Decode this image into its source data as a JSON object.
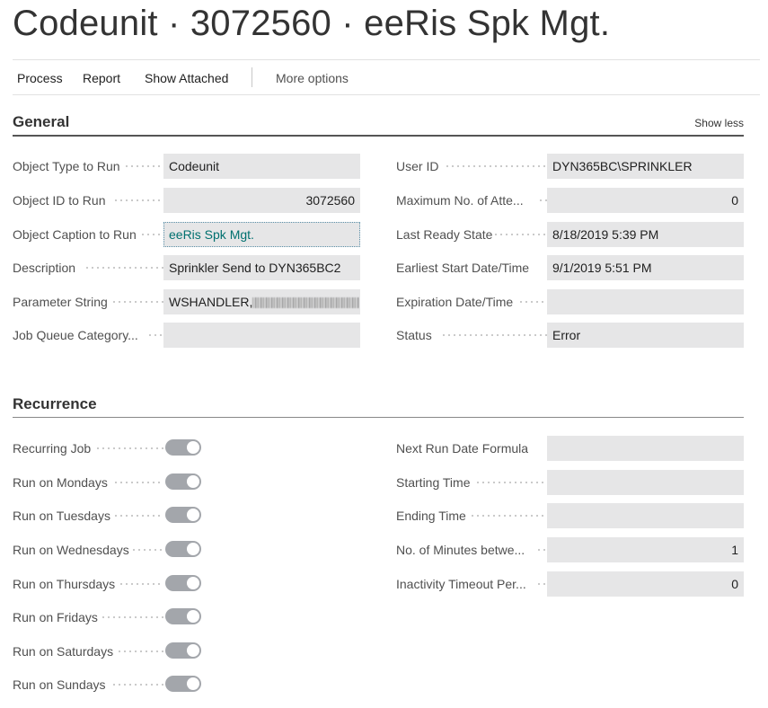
{
  "page": {
    "title": "Codeunit · 3072560 · eeRis Spk Mgt."
  },
  "toolbar": {
    "process": "Process",
    "report": "Report",
    "show_attached": "Show Attached",
    "more_options": "More options"
  },
  "general": {
    "title": "General",
    "show_less": "Show less",
    "left": [
      {
        "label": "Object Type to Run",
        "value": "Codeunit"
      },
      {
        "label": "Object ID to Run",
        "value": "3072560"
      },
      {
        "label": "Object Caption to Run",
        "value": "eeRis Spk Mgt."
      },
      {
        "label": "Description",
        "value": "Sprinkler Send to DYN365BC2"
      },
      {
        "label": "Parameter String",
        "value": "WSHANDLER,"
      },
      {
        "label": "Job Queue Category...",
        "value": ""
      }
    ],
    "right": [
      {
        "label": "User ID",
        "value": "DYN365BC\\SPRINKLER"
      },
      {
        "label": "Maximum No. of Atte...",
        "value": "0"
      },
      {
        "label": "Last Ready State",
        "value": "8/18/2019 5:39 PM"
      },
      {
        "label": "Earliest Start Date/Time",
        "value": "9/1/2019 5:51 PM"
      },
      {
        "label": "Expiration Date/Time",
        "value": ""
      },
      {
        "label": "Status",
        "value": "Error"
      }
    ]
  },
  "recurrence": {
    "title": "Recurrence",
    "left": [
      {
        "label": "Recurring Job"
      },
      {
        "label": "Run on Mondays"
      },
      {
        "label": "Run on Tuesdays"
      },
      {
        "label": "Run on Wednesdays"
      },
      {
        "label": "Run on Thursdays"
      },
      {
        "label": "Run on Fridays"
      },
      {
        "label": "Run on Saturdays"
      },
      {
        "label": "Run on Sundays"
      }
    ],
    "right": [
      {
        "label": "Next Run Date Formula",
        "value": ""
      },
      {
        "label": "Starting Time",
        "value": ""
      },
      {
        "label": "Ending Time",
        "value": ""
      },
      {
        "label": "No. of Minutes betwe...",
        "value": "1"
      },
      {
        "label": "Inactivity Timeout Per...",
        "value": "0"
      }
    ]
  },
  "colors": {
    "link": "#00706f",
    "field_bg": "#e6e6e7",
    "toggle_bg": "#a3a6ab"
  }
}
